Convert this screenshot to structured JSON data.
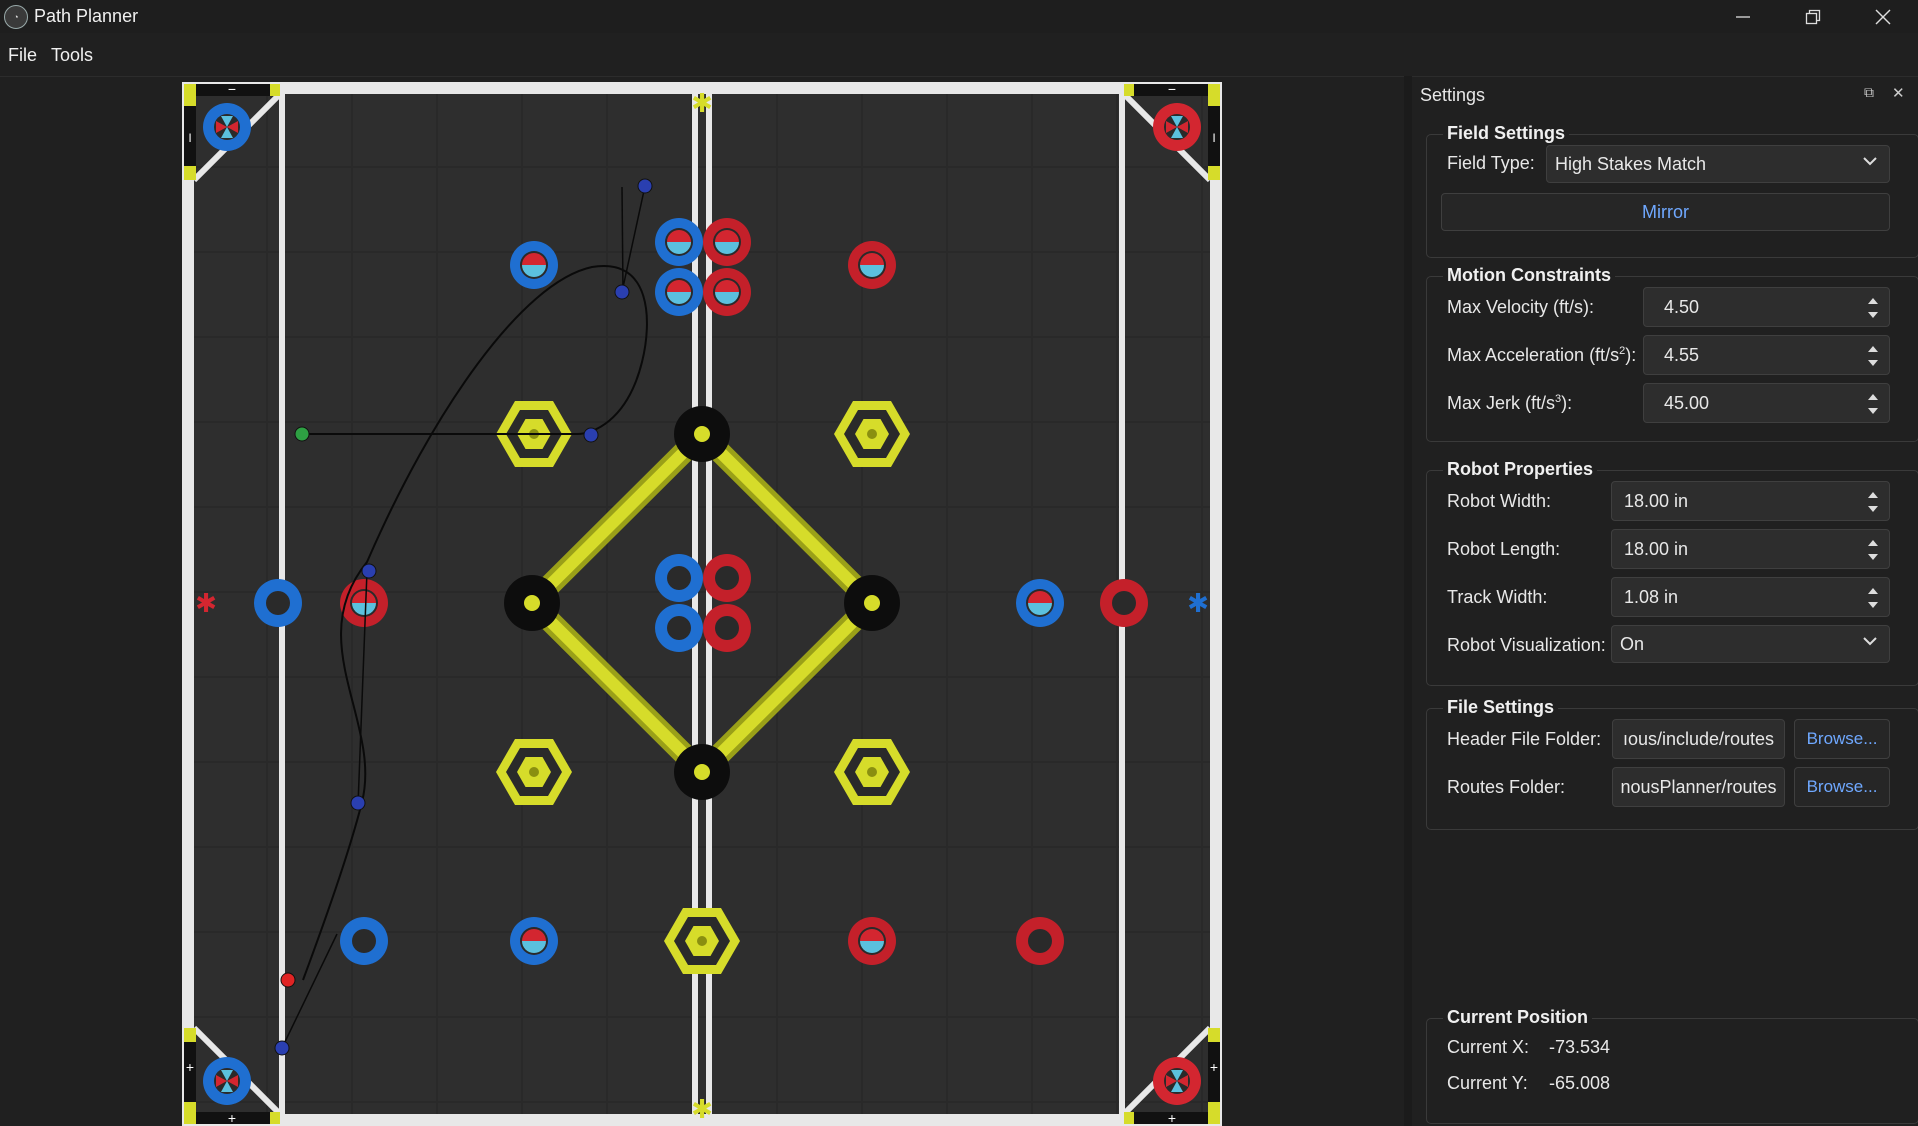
{
  "window": {
    "title": "Path Planner",
    "icon": "app-logo-icon"
  },
  "menu": {
    "items": [
      "File",
      "Tools"
    ]
  },
  "field": {
    "name": "High Stakes Match",
    "corner_signs": {
      "top_left": "−",
      "top_right": "−",
      "bottom_left": "+",
      "bottom_right": "+",
      "side_left_top": "I",
      "side_right_top": "I",
      "side_left_bottom": "+",
      "side_right_bottom": "+"
    },
    "colors": {
      "red": "#d32630",
      "blue": "#1f6fd1",
      "yellow": "#d6dc2a",
      "tile": "#2e2e2e",
      "wall": "#e8e8e8"
    },
    "path": {
      "start_point_color": "#2ea043",
      "end_point_color": "#e02424",
      "control_point_color": "#2a3fb0"
    }
  },
  "settings": {
    "title": "Settings",
    "float_icon": "float-icon",
    "close_icon": "close-icon",
    "field_settings": {
      "title": "Field Settings",
      "field_type_label": "Field Type:",
      "field_type_value": "High Stakes Match",
      "mirror_label": "Mirror"
    },
    "motion": {
      "title": "Motion Constraints",
      "max_velocity_label": "Max Velocity (ft/s):",
      "max_velocity": "4.50",
      "max_accel_label_pre": "Max Acceleration (ft/s",
      "max_accel_label_sup": "2",
      "max_accel_label_post": "):",
      "max_accel": "4.55",
      "max_jerk_label_pre": "Max Jerk (ft/s",
      "max_jerk_label_sup": "3",
      "max_jerk_label_post": "):",
      "max_jerk": "45.00"
    },
    "robot": {
      "title": "Robot Properties",
      "width_label": "Robot Width:",
      "width": "18.00 in",
      "length_label": "Robot Length:",
      "length": "18.00 in",
      "track_label": "Track Width:",
      "track": "1.08 in",
      "viz_label": "Robot Visualization:",
      "viz": "On"
    },
    "files": {
      "title": "File Settings",
      "header_label": "Header File Folder:",
      "header_value": "ıous/include/routes",
      "routes_label": "Routes Folder:",
      "routes_value": "nousPlanner/routes",
      "browse_label": "Browse..."
    },
    "position": {
      "title": "Current Position",
      "x_label": "Current X:",
      "x": "-73.534",
      "y_label": "Current Y:",
      "y": "-65.008"
    }
  }
}
